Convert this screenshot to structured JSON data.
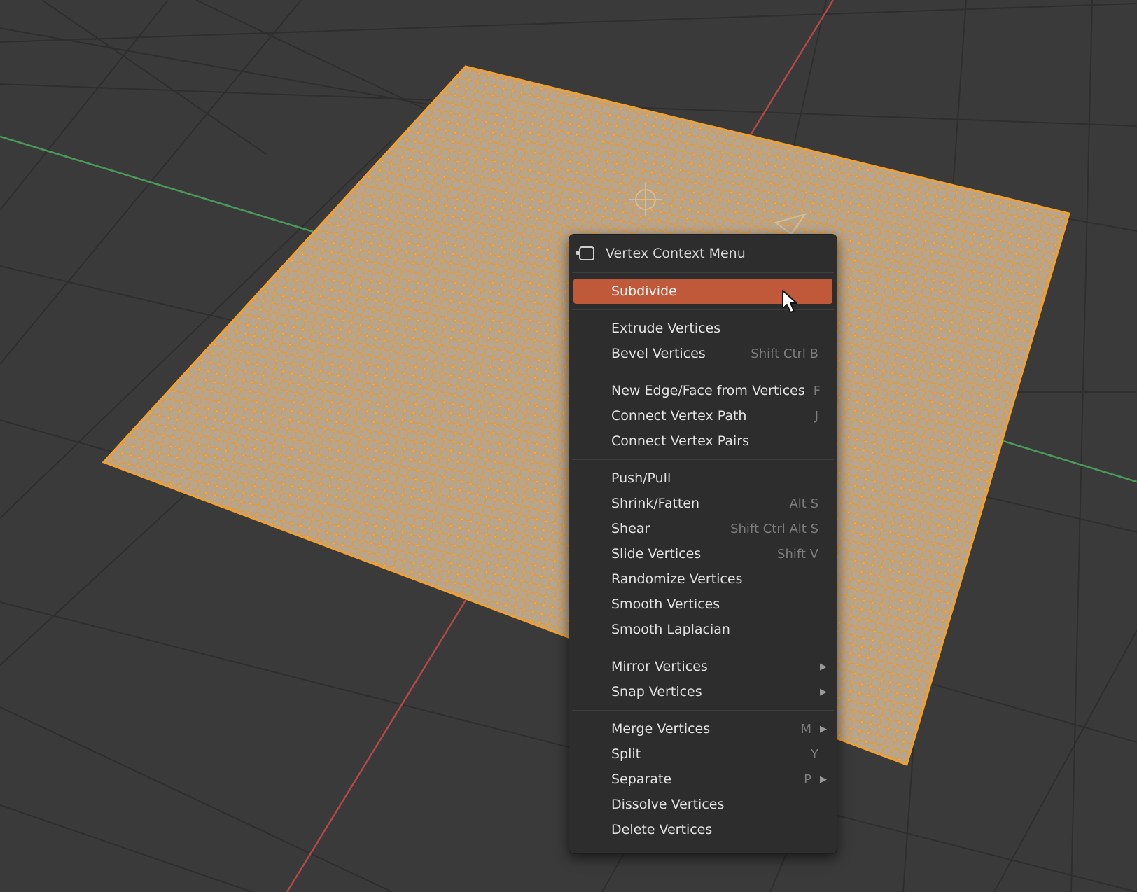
{
  "menu": {
    "title": "Vertex Context Menu",
    "title_icon": "context-menu-icon",
    "groups": [
      [
        {
          "label": "Subdivide",
          "shortcut": "",
          "active": true
        }
      ],
      [
        {
          "label": "Extrude Vertices",
          "shortcut": ""
        },
        {
          "label": "Bevel Vertices",
          "shortcut": "Shift Ctrl B"
        }
      ],
      [
        {
          "label": "New Edge/Face from Vertices",
          "shortcut": "F"
        },
        {
          "label": "Connect Vertex Path",
          "shortcut": "J"
        },
        {
          "label": "Connect Vertex Pairs",
          "shortcut": ""
        }
      ],
      [
        {
          "label": "Push/Pull",
          "shortcut": ""
        },
        {
          "label": "Shrink/Fatten",
          "shortcut": "Alt S"
        },
        {
          "label": "Shear",
          "shortcut": "Shift Ctrl Alt S"
        },
        {
          "label": "Slide Vertices",
          "shortcut": "Shift V"
        },
        {
          "label": "Randomize Vertices",
          "shortcut": ""
        },
        {
          "label": "Smooth Vertices",
          "shortcut": ""
        },
        {
          "label": "Smooth Laplacian",
          "shortcut": ""
        }
      ],
      [
        {
          "label": "Mirror Vertices",
          "shortcut": "",
          "submenu": true
        },
        {
          "label": "Snap Vertices",
          "shortcut": "",
          "submenu": true
        }
      ],
      [
        {
          "label": "Merge Vertices",
          "shortcut": "M",
          "submenu": true
        },
        {
          "label": "Split",
          "shortcut": "Y"
        },
        {
          "label": "Separate",
          "shortcut": "P",
          "submenu": true
        },
        {
          "label": "Dissolve Vertices",
          "shortcut": ""
        },
        {
          "label": "Delete Vertices",
          "shortcut": ""
        }
      ]
    ]
  },
  "colors": {
    "viewport_bg": "#3a3a3a",
    "mesh_face": "#b8a58e",
    "mesh_selected": "#f0a030",
    "active_item": "#c0583a",
    "menu_bg": "#2d2d2d",
    "x_axis": "#b04848",
    "y_axis": "#4a9a5a"
  },
  "icons": {
    "cursor": "mouse-pointer-icon",
    "light": "light-object-icon",
    "camera": "camera-object-icon"
  }
}
